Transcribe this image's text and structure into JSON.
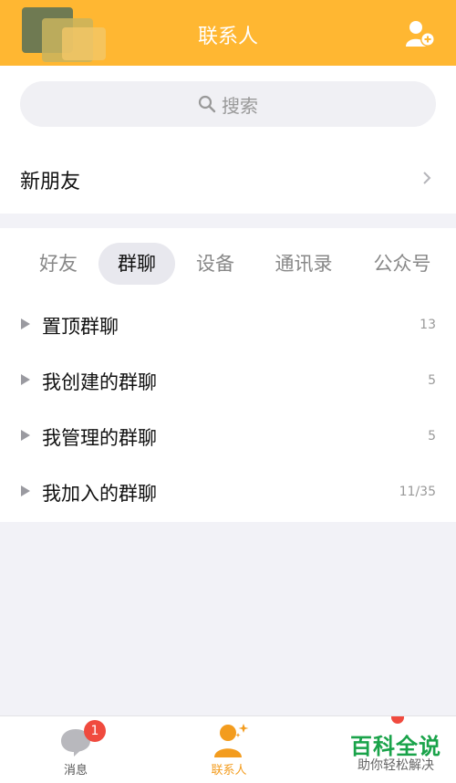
{
  "header": {
    "title": "联系人"
  },
  "search": {
    "placeholder": "搜索"
  },
  "new_friend": {
    "label": "新朋友"
  },
  "tabs": [
    {
      "label": "好友",
      "active": false
    },
    {
      "label": "群聊",
      "active": true
    },
    {
      "label": "设备",
      "active": false
    },
    {
      "label": "通讯录",
      "active": false
    },
    {
      "label": "公众号",
      "active": false
    }
  ],
  "groups": [
    {
      "label": "置顶群聊",
      "count": "13"
    },
    {
      "label": "我创建的群聊",
      "count": "5"
    },
    {
      "label": "我管理的群聊",
      "count": "5"
    },
    {
      "label": "我加入的群聊",
      "count": "11/35"
    }
  ],
  "tabbar": {
    "messages": {
      "label": "消息",
      "badge": "1"
    },
    "contacts": {
      "label": "联系人"
    }
  },
  "watermark": {
    "main": "百科全说",
    "sub": "助你轻松解决"
  },
  "colors": {
    "accent": "#ffb732",
    "badge": "#f04a3e",
    "active_tab_label": "#f39c1e",
    "watermark": "#1aa34a"
  }
}
